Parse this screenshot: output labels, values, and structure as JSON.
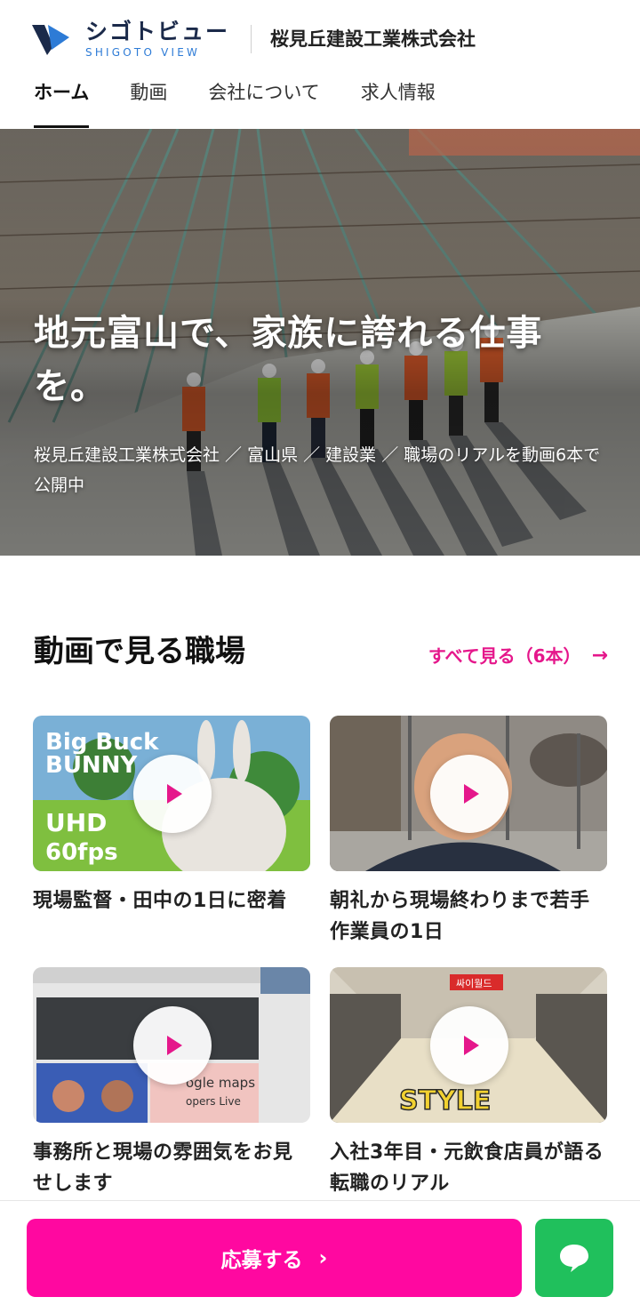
{
  "brand": {
    "logo_ja": "シゴトビュー",
    "logo_en": "SHIGOTO VIEW",
    "company": "桜見丘建設工業株式会社"
  },
  "nav": {
    "items": [
      {
        "label": "ホーム",
        "active": true
      },
      {
        "label": "動画"
      },
      {
        "label": "会社について"
      },
      {
        "label": "求人情報"
      }
    ]
  },
  "hero": {
    "title": "地元富山で、家族に誇れる仕事を。",
    "subtitle": "桜見丘建設工業株式会社 ／ 富山県 ／ 建設業 ／ 職場のリアルを動画6本で公開中"
  },
  "videos_section": {
    "title": "動画で見る職場",
    "see_all": "すべて見る（6本）",
    "see_all_arrow": "→",
    "items": [
      {
        "title": "現場監督・田中の1日に密着",
        "thumb_text_1": "Big Buck",
        "thumb_text_2": "BUNNY",
        "thumb_text_3": "UHD",
        "thumb_text_4": "60fps"
      },
      {
        "title": "朝礼から現場終わりまで若手作業員の1日"
      },
      {
        "title": "事務所と現場の雰囲気をお見せします",
        "thumb_text_1": "ogle maps",
        "thumb_text_2": "opers Live"
      },
      {
        "title": "入社3年目・元飲食店員が語る転職のリアル",
        "thumb_text_1": "STYLE",
        "thumb_text_2": "싸이월드"
      }
    ]
  },
  "bottom": {
    "apply_label": "応募する",
    "apply_chevron": "›"
  },
  "colors": {
    "accent_pink": "#e5178b",
    "apply_pink": "#ff08a0",
    "chat_green": "#20c05c",
    "navy": "#1b2a4a"
  },
  "icons": [
    "logo-mark-icon",
    "arrow-right-icon",
    "play-icon",
    "chevron-right-icon",
    "chat-bubble-icon"
  ]
}
